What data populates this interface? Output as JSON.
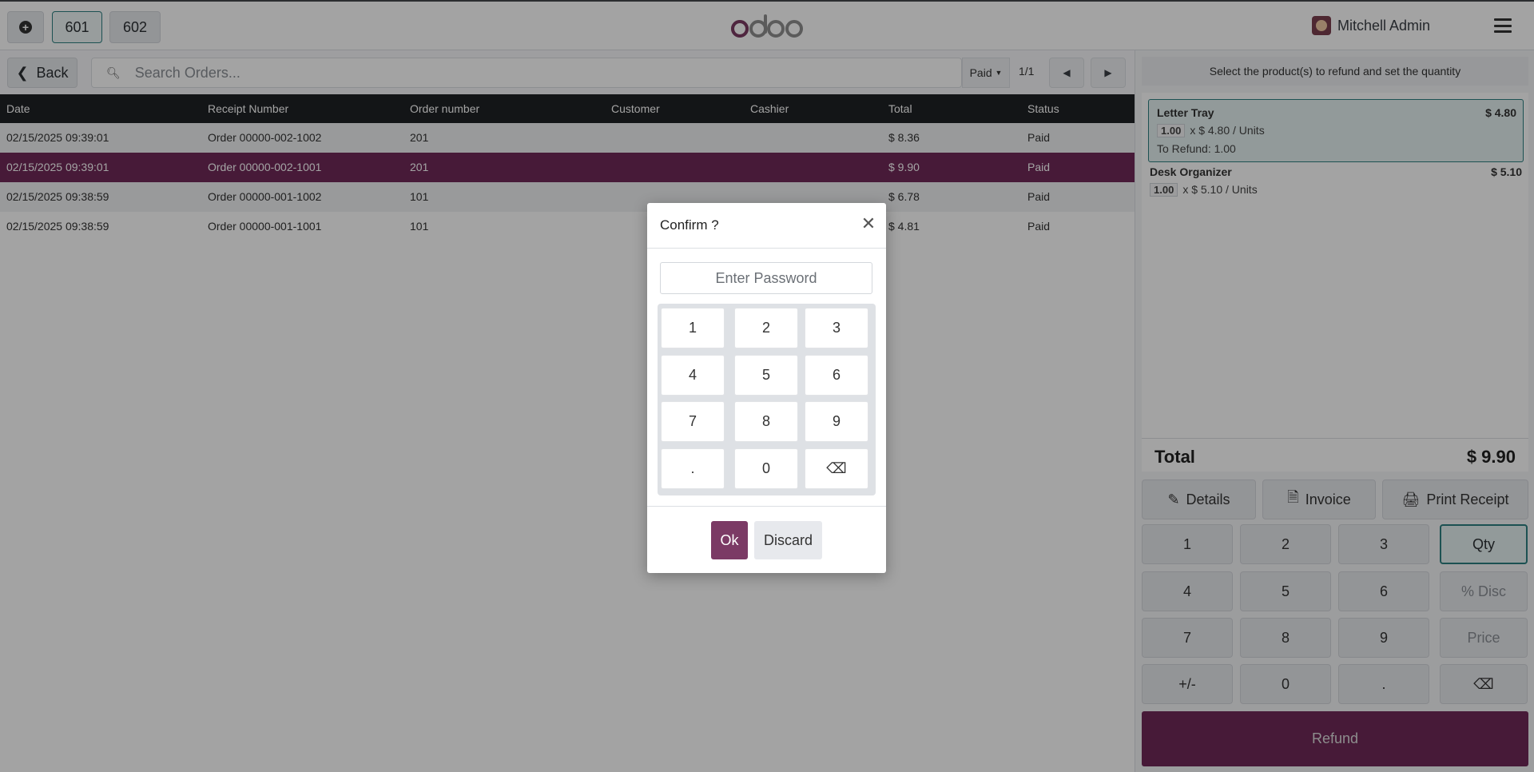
{
  "topbar": {
    "tabs": [
      "601",
      "602"
    ],
    "logo_text": "odoo",
    "user_name": "Mitchell Admin"
  },
  "orders": {
    "back_label": "Back",
    "search_placeholder": "Search Orders...",
    "filter_label": "Paid",
    "pager": "1/1",
    "columns": [
      "Date",
      "Receipt Number",
      "Order number",
      "Customer",
      "Cashier",
      "Total",
      "Status"
    ],
    "rows": [
      {
        "date": "02/15/2025 09:39:01",
        "receipt": "Order 00000-002-1002",
        "order_number": "201",
        "customer": "",
        "cashier": "",
        "total": "$ 8.36",
        "status": "Paid"
      },
      {
        "date": "02/15/2025 09:39:01",
        "receipt": "Order 00000-002-1001",
        "order_number": "201",
        "customer": "",
        "cashier": "",
        "total": "$ 9.90",
        "status": "Paid"
      },
      {
        "date": "02/15/2025 09:38:59",
        "receipt": "Order 00000-001-1002",
        "order_number": "101",
        "customer": "",
        "cashier": "",
        "total": "$ 6.78",
        "status": "Paid"
      },
      {
        "date": "02/15/2025 09:38:59",
        "receipt": "Order 00000-001-1001",
        "order_number": "101",
        "customer": "",
        "cashier": "",
        "total": "$ 4.81",
        "status": "Paid"
      }
    ]
  },
  "refund_panel": {
    "header": "Select the product(s) to refund and set the quantity",
    "lines": [
      {
        "name": "Letter Tray",
        "price": "$ 4.80",
        "qty": "1.00",
        "unit_text": "x $ 4.80 / Units",
        "refund_text": "To Refund: 1.00"
      },
      {
        "name": "Desk Organizer",
        "price": "$ 5.10",
        "qty": "1.00",
        "unit_text": "x $ 5.10 / Units"
      }
    ],
    "total_label": "Total",
    "total_value": "$ 9.90",
    "actions": {
      "details": "Details",
      "invoice": "Invoice",
      "print": "Print Receipt"
    },
    "numpad": [
      "1",
      "2",
      "3",
      "Qty",
      "4",
      "5",
      "6",
      "% Disc",
      "7",
      "8",
      "9",
      "Price",
      "+/-",
      "0",
      ".",
      "⌫"
    ],
    "refund_label": "Refund"
  },
  "dialog": {
    "title": "Confirm ?",
    "password_placeholder": "Enter Password",
    "keys": [
      "1",
      "2",
      "3",
      "4",
      "5",
      "6",
      "7",
      "8",
      "9",
      ".",
      "0",
      "⌫"
    ],
    "ok_label": "Ok",
    "discard_label": "Discard"
  },
  "colors": {
    "brand": "#6f2a58",
    "accent": "#2d7f80"
  }
}
